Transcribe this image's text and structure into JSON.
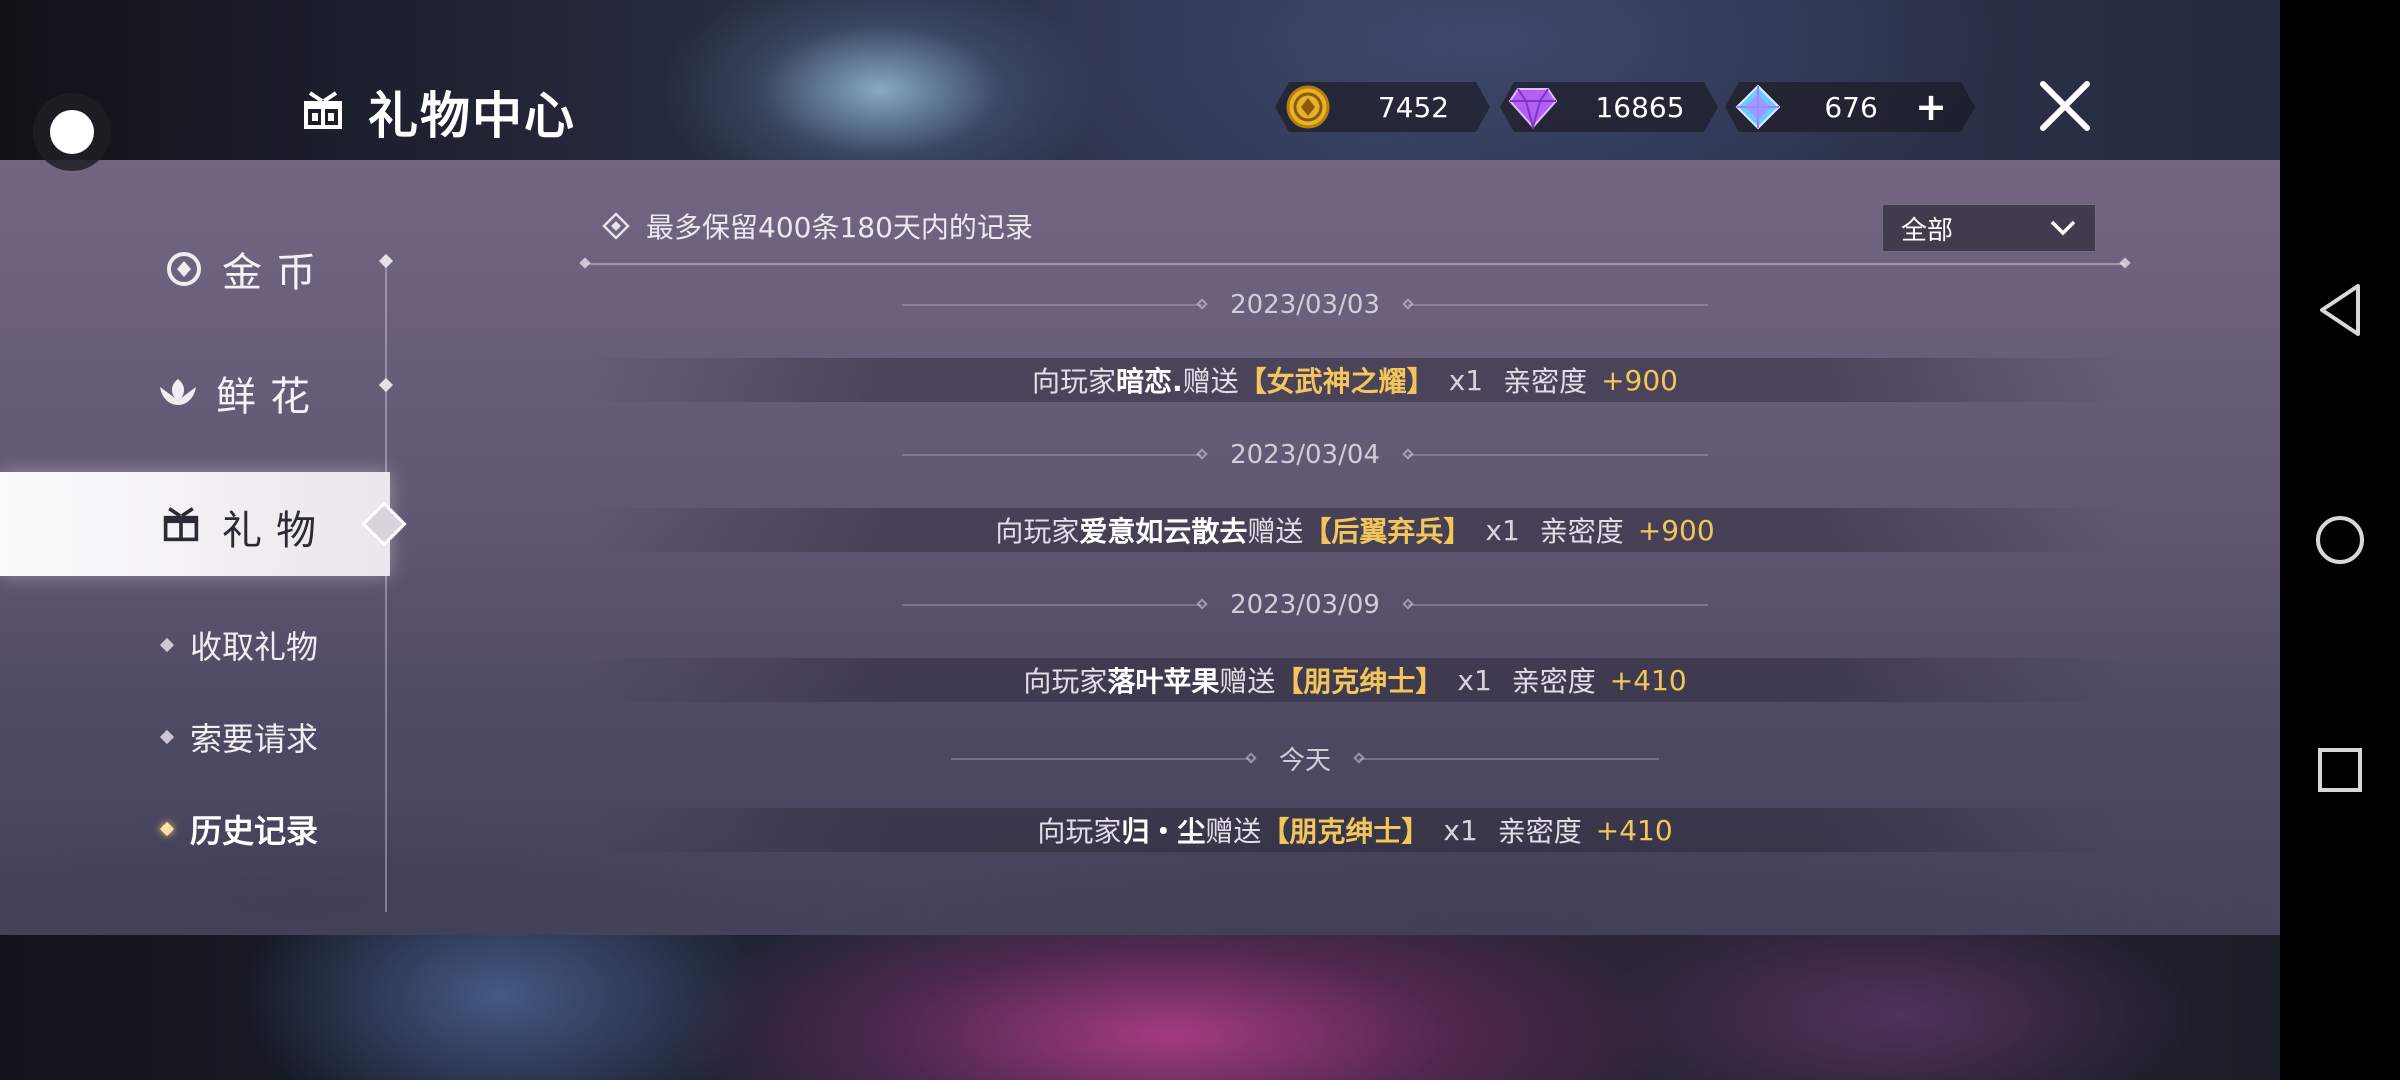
{
  "header": {
    "title": "礼物中心",
    "currencies": [
      {
        "name": "gold-coin",
        "value": "7452"
      },
      {
        "name": "purple-diamond",
        "value": "16865"
      },
      {
        "name": "blue-crystal",
        "value": "676"
      }
    ],
    "add_symbol": "+"
  },
  "sidebar": {
    "items": [
      {
        "label": "金币"
      },
      {
        "label": "鲜花"
      },
      {
        "label": "礼物"
      }
    ],
    "sub_items": [
      {
        "label": "收取礼物"
      },
      {
        "label": "索要请求"
      },
      {
        "label": "历史记录"
      }
    ]
  },
  "main": {
    "notice": "最多保留400条180天内的记录",
    "filter": {
      "selected": "全部"
    },
    "groups": [
      {
        "date": "2023/03/03",
        "prefix": "向玩家",
        "player": "暗恋.",
        "verb": "赠送",
        "gift": "【女武神之耀】",
        "qty": "x1",
        "label": "亲密度",
        "points": "+900"
      },
      {
        "date": "2023/03/04",
        "prefix": "向玩家",
        "player": "爱意如云散去",
        "verb": "赠送",
        "gift": "【后翼弃兵】",
        "qty": "x1",
        "label": "亲密度",
        "points": "+900"
      },
      {
        "date": "2023/03/09",
        "prefix": "向玩家",
        "player": "落叶苹果",
        "verb": "赠送",
        "gift": "【朋克绅士】",
        "qty": "x1",
        "label": "亲密度",
        "points": "+410"
      },
      {
        "date": "今天",
        "prefix": "向玩家",
        "player": "归・尘",
        "verb": "赠送",
        "gift": "【朋克绅士】",
        "qty": "x1",
        "label": "亲密度",
        "points": "+410"
      }
    ]
  },
  "colors": {
    "accent_gold": "#f2c65a",
    "panel": "#6e6382",
    "active_tab": "#ffffff"
  },
  "icons": [
    "gift-box-icon",
    "gold-coin-icon",
    "purple-gem-icon",
    "blue-crystal-icon",
    "close-icon",
    "coin-icon",
    "flower-icon",
    "diamond-bullet-icon",
    "chevron-down-icon",
    "back-triangle-icon",
    "home-circle-icon",
    "recents-square-icon"
  ]
}
